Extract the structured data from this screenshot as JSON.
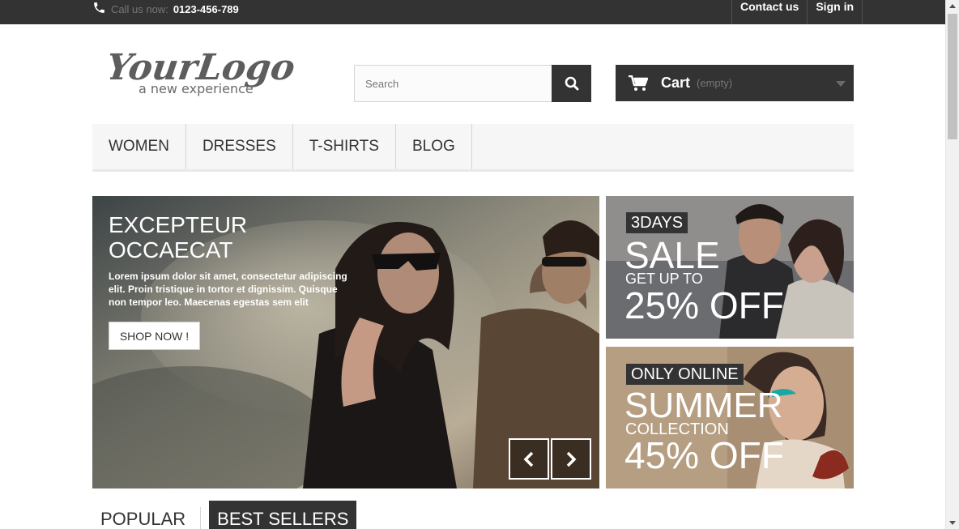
{
  "topbar": {
    "call_label": "Call us now:",
    "phone_number": "0123-456-789",
    "contact_label": "Contact us",
    "signin_label": "Sign in"
  },
  "header": {
    "logo_text": "YourLogo",
    "logo_tagline": "a new experience",
    "search_placeholder": "Search",
    "cart_label": "Cart",
    "cart_status": "(empty)"
  },
  "menu": {
    "items": [
      {
        "label": "WOMEN"
      },
      {
        "label": "DRESSES"
      },
      {
        "label": "T-SHIRTS"
      },
      {
        "label": "BLOG"
      }
    ]
  },
  "slider": {
    "title": "EXCEPTEUR\nOCCAECAT",
    "description": "Lorem ipsum dolor sit amet, consectetur adipiscing elit. Proin tristique in tortor et dignissim. Quisque non tempor leo. Maecenas egestas sem elit",
    "button_label": "SHOP NOW !"
  },
  "banners": [
    {
      "badge": "3DAYS",
      "headline": "SALE",
      "subline": "GET UP TO",
      "offer": "25% OFF"
    },
    {
      "badge": "ONLY ONLINE",
      "headline": "SUMMER",
      "subline": "COLLECTION",
      "offer": "45% OFF"
    }
  ],
  "tabs": [
    {
      "label": "POPULAR",
      "active": false
    },
    {
      "label": "BEST SELLERS",
      "active": true
    }
  ],
  "colors": {
    "dark": "#333333",
    "menu_bg": "#f6f6f6",
    "muted": "#777777"
  }
}
